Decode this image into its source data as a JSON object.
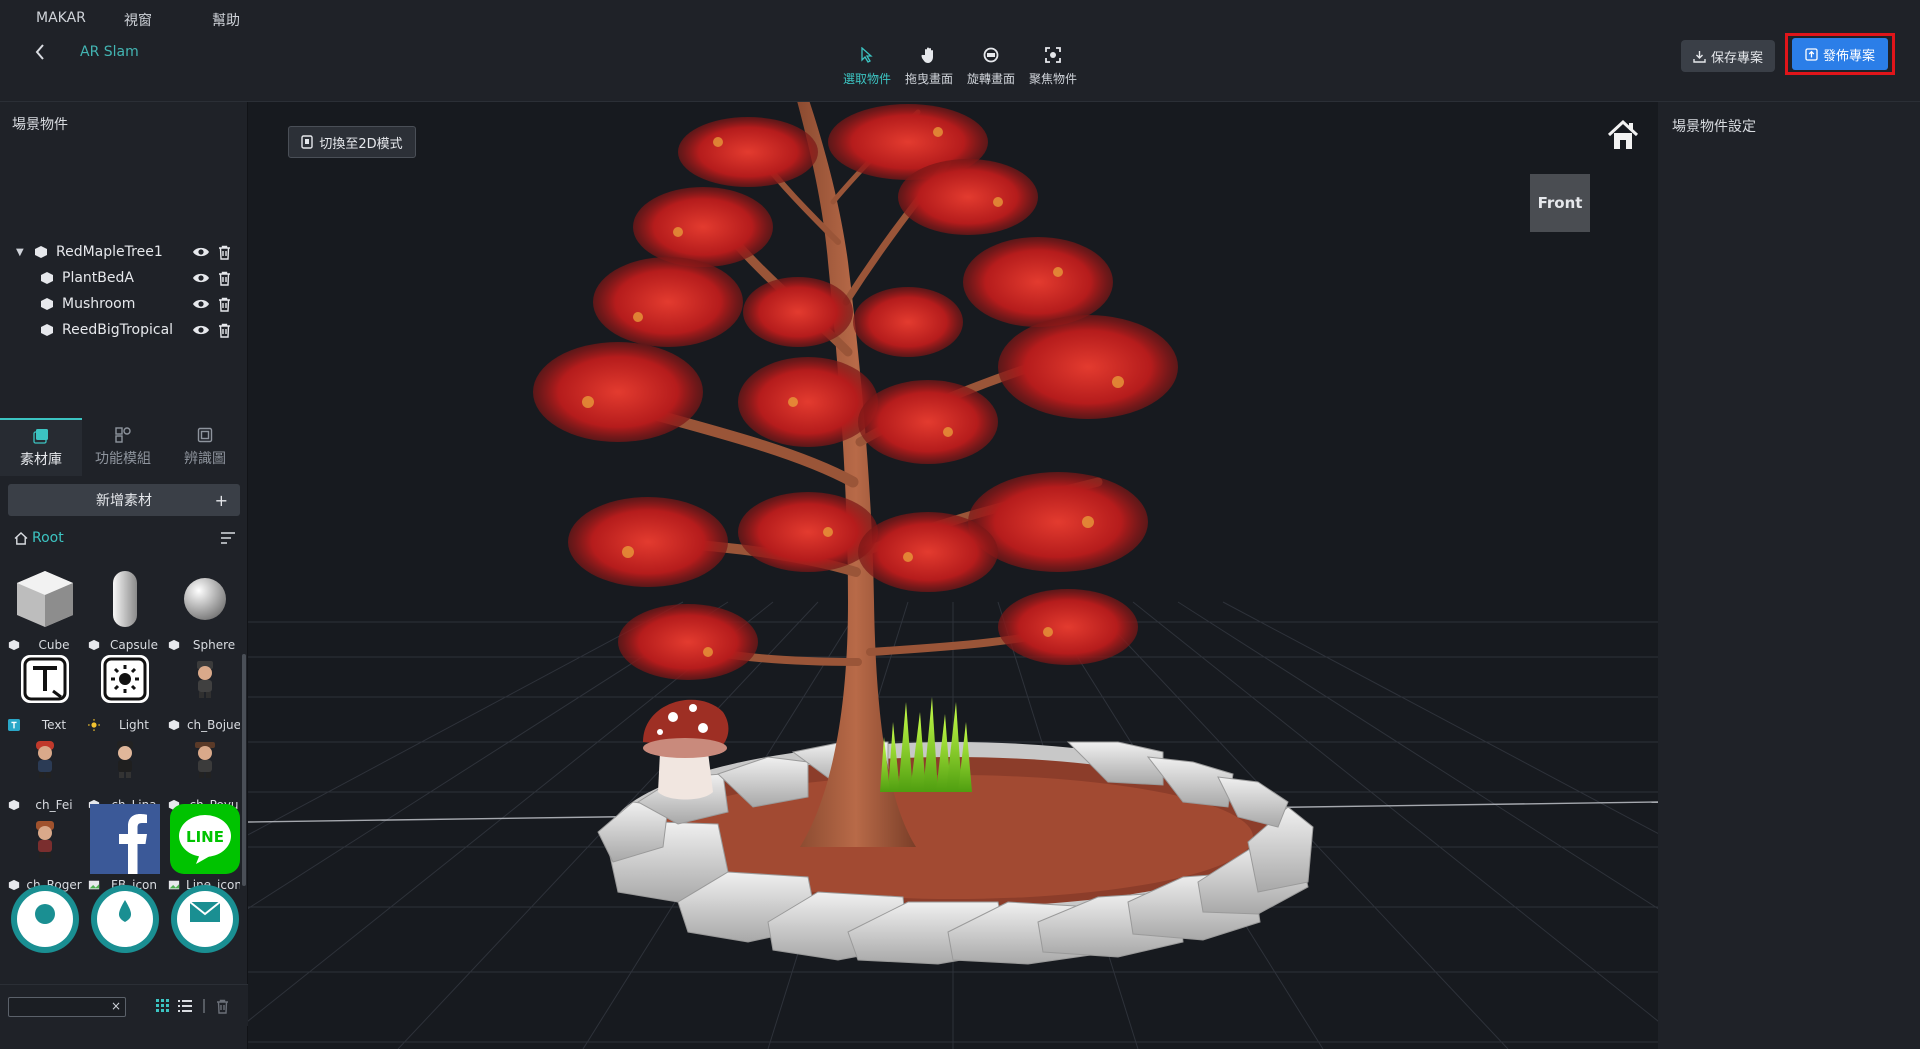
{
  "menu": {
    "items": [
      "MAKAR",
      "視窗",
      "幫助"
    ]
  },
  "project": {
    "name": "AR Slam"
  },
  "toolbar": {
    "tools": [
      {
        "label": "選取物件",
        "icon": "cursor-icon",
        "active": true
      },
      {
        "label": "拖曳畫面",
        "icon": "hand-icon",
        "active": false
      },
      {
        "label": "旋轉畫面",
        "icon": "rotate-icon",
        "active": false
      },
      {
        "label": "聚焦物件",
        "icon": "focus-icon",
        "active": false
      }
    ],
    "save_label": "保存專案",
    "publish_label": "發佈專案"
  },
  "scene": {
    "title": "場景物件",
    "objects": [
      {
        "name": "RedMapleTree1",
        "expanded": true,
        "level": 0
      },
      {
        "name": "PlantBedA",
        "level": 1
      },
      {
        "name": "Mushroom",
        "level": 1
      },
      {
        "name": "ReedBigTropical",
        "level": 1
      }
    ]
  },
  "library": {
    "tabs": [
      {
        "label": "素材庫",
        "icon": "assets-icon",
        "active": true
      },
      {
        "label": "功能模組",
        "icon": "modules-icon",
        "active": false
      },
      {
        "label": "辨識圖",
        "icon": "target-image-icon",
        "active": false
      }
    ],
    "add_label": "新增素材",
    "add_symbol": "+",
    "root_label": "Root",
    "assets": [
      {
        "name": "Cube",
        "kind": "cube"
      },
      {
        "name": "Capsule",
        "kind": "capsule"
      },
      {
        "name": "Sphere",
        "kind": "sphere"
      },
      {
        "name": "Text",
        "kind": "text"
      },
      {
        "name": "Light",
        "kind": "light"
      },
      {
        "name": "ch_Bojue",
        "kind": "character"
      },
      {
        "name": "ch_Fei",
        "kind": "character"
      },
      {
        "name": "ch_Lina",
        "kind": "character"
      },
      {
        "name": "ch_Poyu",
        "kind": "character"
      },
      {
        "name": "ch_Roger",
        "kind": "character"
      },
      {
        "name": "FB_icon",
        "kind": "facebook"
      },
      {
        "name": "Line_icon",
        "kind": "line"
      }
    ],
    "search_clear": "×",
    "line_logo_text": "LINE"
  },
  "viewport": {
    "switch_label": "切換至2D模式",
    "view_label": "Front"
  },
  "properties": {
    "title": "場景物件設定"
  },
  "colors": {
    "accent": "#3cc4c2",
    "publish": "#2b7ee8",
    "highlight": "#e0151a"
  }
}
